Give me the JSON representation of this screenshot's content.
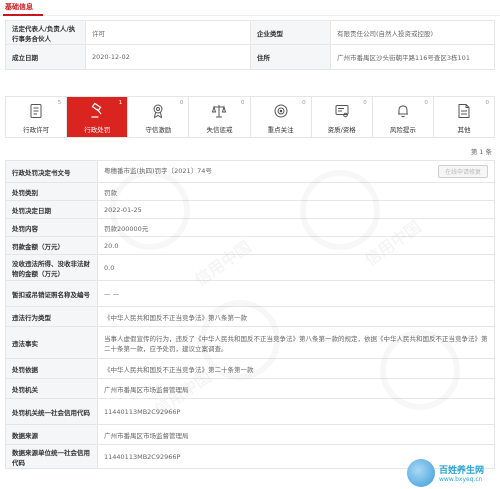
{
  "tab": {
    "label": "基础信息"
  },
  "base_info": {
    "rows": [
      {
        "label1": "法定代表人/负责人/执行事务合伙人",
        "value1": "许可",
        "label2": "企业类型",
        "value2": "有限责任公司(自然人投资或控股)"
      },
      {
        "label1": "成立日期",
        "value1": "2020-12-02",
        "label2": "住所",
        "value2": "广州市番禺区沙头街朝平路116号查区3栋101"
      }
    ]
  },
  "categories": [
    {
      "name": "行政许可",
      "count": "5",
      "icon": "document-icon",
      "active": false
    },
    {
      "name": "行政处罚",
      "count": "1",
      "icon": "gavel-icon",
      "active": true
    },
    {
      "name": "守信激励",
      "count": "0",
      "icon": "award-icon",
      "active": false
    },
    {
      "name": "失信惩戒",
      "count": "0",
      "icon": "scale-icon",
      "active": false
    },
    {
      "name": "重点关注",
      "count": "0",
      "icon": "target-icon",
      "active": false
    },
    {
      "name": "资质/资格",
      "count": "0",
      "icon": "certificate-icon",
      "active": false
    },
    {
      "name": "风险提示",
      "count": "0",
      "icon": "bell-icon",
      "active": false
    },
    {
      "name": "其他",
      "count": "0",
      "icon": "file-icon",
      "active": false
    }
  ],
  "pager": {
    "prefix": "第",
    "page": "1",
    "suffix": "条"
  },
  "online_btn": "在线申请修复",
  "details": [
    {
      "label": "行政处罚决定书文号",
      "value": "粤穗番市监(执四)罚字〔2021〕74号",
      "h": 22
    },
    {
      "label": "处罚类别",
      "value": "罚款",
      "h": 18
    },
    {
      "label": "处罚决定日期",
      "value": "2022-01-25",
      "h": 18
    },
    {
      "label": "处罚内容",
      "value": "罚款200000元",
      "h": 18
    },
    {
      "label": "罚款金额（万元）",
      "value": "20.0",
      "h": 18
    },
    {
      "label": "没收违法所得、没收非法财物的金额（万元）",
      "value": "0.0",
      "h": 26
    },
    {
      "label": "暂扣或吊销证照名称及编号",
      "value": "— —",
      "h": 26
    },
    {
      "label": "违法行为类型",
      "value": "《中华人民共和国反不正当竞争法》第八条第一款",
      "h": 20
    },
    {
      "label": "违法事实",
      "value": "当事人虚假宣传的行为，违反了《中华人民共和国反不正当竞争法》第八条第一款的规定，依据《中华人民共和国反不正当竞争法》第二十条第一款，应予处罚，建议立案调查。",
      "h": 32
    },
    {
      "label": "处罚依据",
      "value": "《中华人民共和国反不正当竞争法》第二十条第一款",
      "h": 20
    },
    {
      "label": "处罚机关",
      "value": "广州市番禺区市场监督管理局",
      "h": 20
    },
    {
      "label": "处罚机关统一社会信用代码",
      "value": "11440113MB2C92966P",
      "h": 26
    },
    {
      "label": "数据来源",
      "value": "广州市番禺区市场监督管理局",
      "h": 20
    },
    {
      "label": "数据来源单位统一社会信用代码",
      "value": "11440113MB2C92966P",
      "h": 24
    }
  ],
  "watermark": "信用中国",
  "corner": {
    "title": "百姓养生网",
    "url": "www.bxyeq.cn"
  }
}
